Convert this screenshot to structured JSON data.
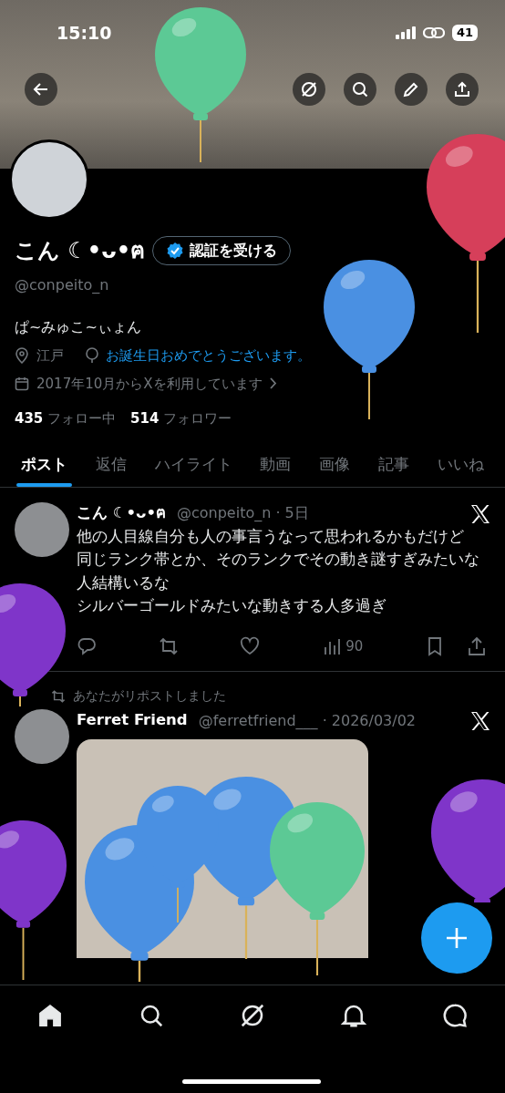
{
  "status_bar": {
    "time": "15:10",
    "battery": "41"
  },
  "profile": {
    "name": "こん ☾•ᴗ•ฅ",
    "verify_button": "認証を受ける",
    "handle": "@conpeito_n",
    "bio": "ぱ~みゅこ~ぃょん",
    "location": "江戸",
    "birthday": "お誕生日おめでとうございます。",
    "joined": "2017年10月からXを利用しています",
    "following_count": "435",
    "following_label": "フォロー中",
    "followers_count": "514",
    "followers_label": "フォロワー"
  },
  "tabs": [
    {
      "label": "ポスト",
      "selected": true
    },
    {
      "label": "返信",
      "selected": false
    },
    {
      "label": "ハイライト",
      "selected": false
    },
    {
      "label": "動画",
      "selected": false
    },
    {
      "label": "画像",
      "selected": false
    },
    {
      "label": "記事",
      "selected": false
    },
    {
      "label": "いいね",
      "selected": false
    }
  ],
  "posts": [
    {
      "kind": "own",
      "author": "こん ☾•ᴗ•ฅ",
      "meta": "@conpeito_n · 5日",
      "lines": [
        "他の人目線自分も人の事言うなって思われるかもだけど",
        "同じランク帯とか、そのランクでその動き謎すぎみたいな人結構いるな",
        "シルバーゴールドみたいな動きする人多過ぎ"
      ],
      "views": "90"
    },
    {
      "kind": "repost",
      "repost_label": "あなたがリポストしました",
      "author": "Ferret Friend",
      "meta": "@ferretfriend___ · 2026/03/02"
    }
  ],
  "nav": [
    {
      "kind": "home",
      "selected": true
    },
    {
      "kind": "search",
      "selected": false
    },
    {
      "kind": "grok",
      "selected": false
    },
    {
      "kind": "bell",
      "selected": false
    },
    {
      "kind": "chat",
      "selected": false
    }
  ],
  "balloons": [
    {
      "color": "#d63f5a"
    },
    {
      "color": "#4a90e2"
    },
    {
      "color": "#7f35c9"
    },
    {
      "color": "#4a90e2"
    },
    {
      "color": "#4a90e2"
    },
    {
      "color": "#5cc995"
    },
    {
      "color": "#7f35c9"
    },
    {
      "color": "#7f35c9"
    },
    {
      "color": "#5cc995"
    },
    {
      "color": "#4a90e2"
    }
  ]
}
